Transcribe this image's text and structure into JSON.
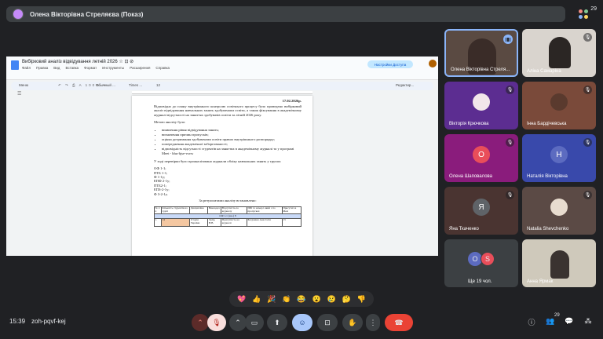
{
  "header": {
    "title": "Олена Вікторівна Стреляєва (Показ)",
    "participant_count": "29"
  },
  "document": {
    "title": "Вибірковий аналіз відвідування летній 2026 ☆ ⊡ ⊘",
    "menu": [
      "Файл",
      "Правка",
      "Вид",
      "Вставка",
      "Формат",
      "Инструменты",
      "Расширения",
      "Справка"
    ],
    "share_label": "Настройки Доступа",
    "toolbar": {
      "search": "Меню",
      "style": "Обычный ...",
      "font": "Times ...",
      "size": "12",
      "editing": "Редактир..."
    },
    "date": "17.02.2026р.",
    "intro": "Відповідно до плану внутрішнього контролю освітнього процесу було проведено вибірковий аналіз відвідування навчальних занять здобувачами освіти, а також фіксування в академічному журналі відсутності на заняттях здобувачів освіти за літній 2026 року.",
    "goal_heading": "Метою аналізу було:",
    "goals": [
      "виявлення рівня відвідування занять;",
      "визначення причин пропусків;",
      "оцінка дотримання здобувачами освіти правил внутрішнього розпорядку;",
      "попередження академічної заборгованості;",
      "відповідність відсутності студентів на заняттях в академічному журналі та у програмі Meet - bhu-hjse-vsvw"
    ],
    "groups_intro": "У ході перевірки було проаналізовано журнали обліку навчальних занять у групах:",
    "groups": [
      "ОФ 1-1;",
      "ПТБ 1-1;",
      "Ф 1-1у;",
      "ЕПФ 2-1у;",
      "ПТБ2-1;",
      "ЕПЗ-2-1у;",
      "Ф 3-2-1у."
    ],
    "results_heading": "За результатами аналізу встановлено:",
    "table": {
      "headers": [
        "№ з/п",
        "Кількість студентів на групі",
        "Дисципліна",
        "Викладач",
        "Відсутність по журналу",
        "ПІБ та номер і який є по пропусках",
        "Присутні за Meet"
      ],
      "band": "ОФ 1-1 (н.в.) 8",
      "row": [
        "1.",
        "14",
        "Історія України",
        "Заєць Н.В.",
        "Присутність на журналі",
        "Богданюк Анастасія",
        "13"
      ]
    }
  },
  "participants": [
    {
      "name": "Олена Вікторівна Стреля...",
      "initial": "",
      "color": "#6d5a4e",
      "active": true
    },
    {
      "name": "Аліна Самаріна",
      "initial": "",
      "color": "#d9d4ce",
      "active": false
    },
    {
      "name": "Вікторія Крючкова",
      "initial": "",
      "color": "#5c2d91",
      "active": false
    },
    {
      "name": "Інна Бардічевська",
      "initial": "",
      "color": "#7a4a3a",
      "active": false
    },
    {
      "name": "Олена Шаповалова",
      "initial": "О",
      "color": "#e94e5a",
      "active": false
    },
    {
      "name": "Наталія Вікторівна",
      "initial": "Н",
      "color": "#3f51b5",
      "active": false
    },
    {
      "name": "Яна Ткаченко",
      "initial": "Я",
      "color": "#5f6368",
      "active": false
    },
    {
      "name": "Natalia Shevchenko",
      "initial": "",
      "color": "#c8a878",
      "active": false
    },
    {
      "name": "Ще 19 чол.",
      "initial": "",
      "color": "",
      "active": false
    },
    {
      "name": "Анна Ярмак",
      "initial": "",
      "color": "#cfc9bb",
      "active": false
    }
  ],
  "more_avatars": [
    "О",
    "S"
  ],
  "reactions": [
    "💖",
    "👍",
    "🎉",
    "👏",
    "😂",
    "😮",
    "😢",
    "🤔",
    "👎"
  ],
  "footer": {
    "time": "15:39",
    "meeting_code": "zoh-pqvf-kej",
    "participants_badge": "29"
  }
}
